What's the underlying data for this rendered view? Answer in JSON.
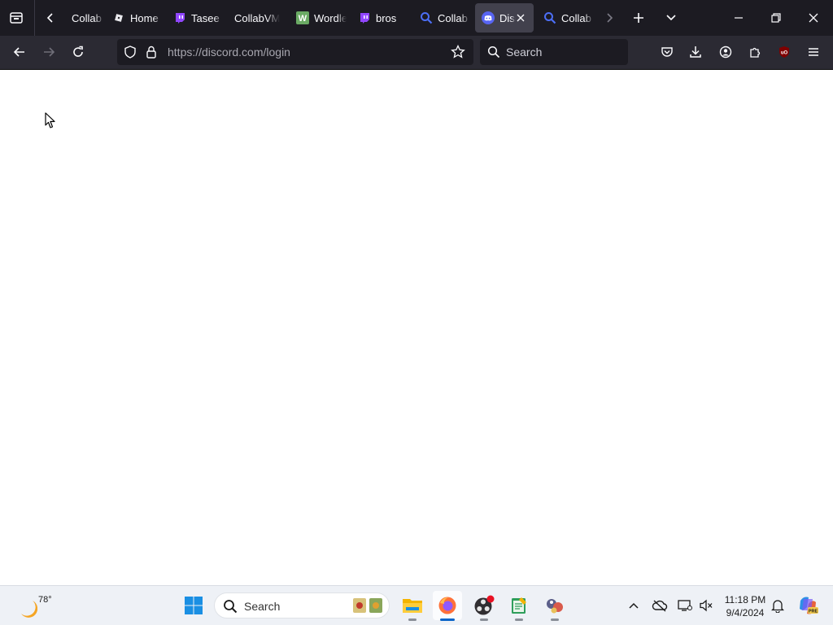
{
  "browser": {
    "tabs": [
      {
        "title": "Collab",
        "icon": "collabvm-icon"
      },
      {
        "title": "Home",
        "icon": "roblox-icon"
      },
      {
        "title": "Tasee",
        "icon": "twitch-icon"
      },
      {
        "title": "CollabVM",
        "icon": "none"
      },
      {
        "title": "Wordle",
        "icon": "wordle-icon"
      },
      {
        "title": "bros",
        "icon": "twitch-icon"
      },
      {
        "title": "Collab",
        "icon": "search-icon"
      },
      {
        "title": "Discord",
        "icon": "discord-icon",
        "active": true
      },
      {
        "title": "Collab",
        "icon": "search-icon"
      }
    ],
    "url_host": "https://discord.com",
    "url_path": "/login",
    "search_placeholder": "Search"
  },
  "taskbar": {
    "weather_temp": "78°",
    "search_placeholder": "Search",
    "time": "11:18 PM",
    "date": "9/4/2024",
    "pinned": [
      "file-explorer-icon",
      "firefox-icon",
      "obs-icon",
      "notepad-icon",
      "app-icon"
    ]
  },
  "colors": {
    "tabbar_bg": "#1c1b22",
    "toolbar_bg": "#2b2a33",
    "discord": "#5865f2",
    "twitch": "#9146ff",
    "accent": "#0a64c8"
  }
}
